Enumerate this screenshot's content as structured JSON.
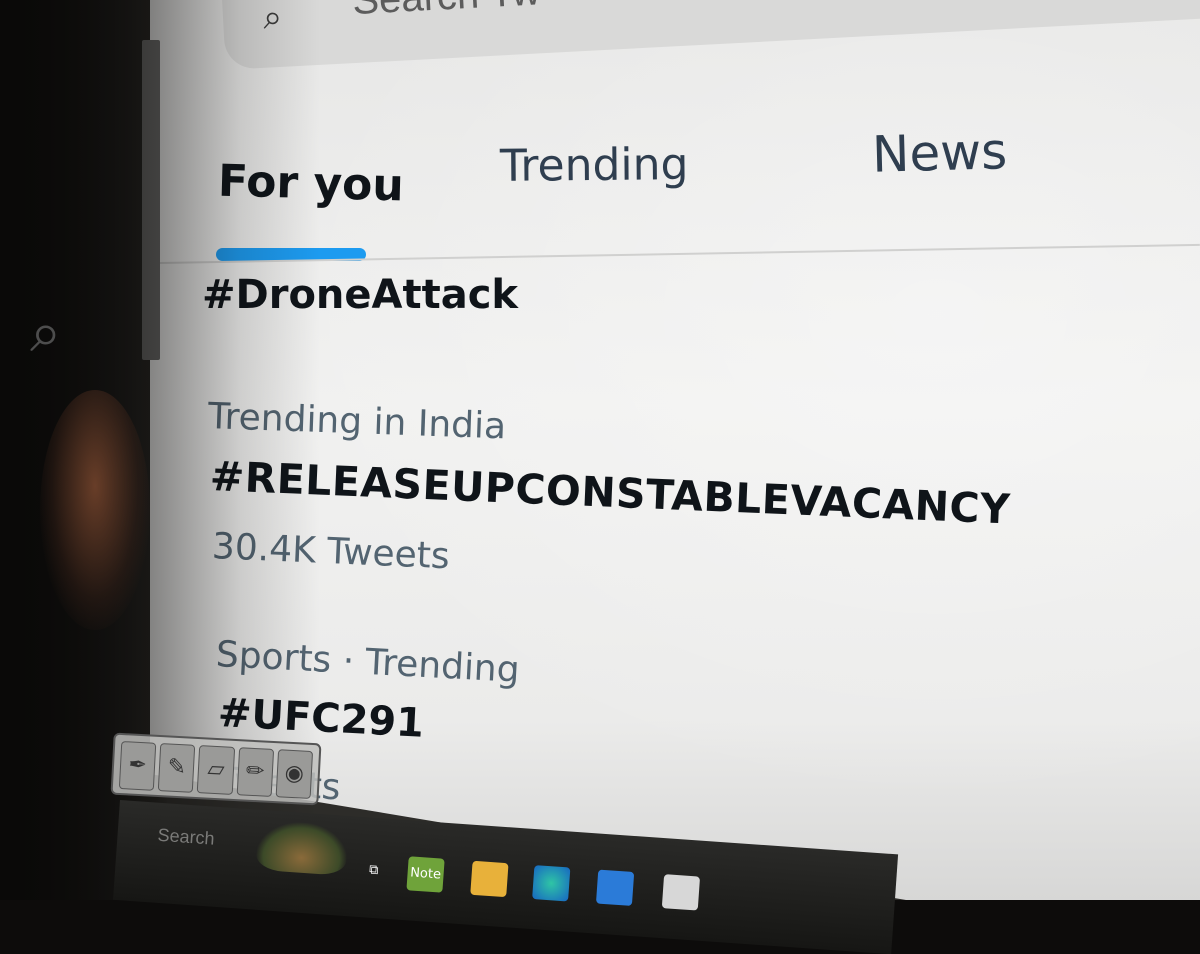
{
  "search": {
    "icon": "search-icon",
    "placeholder": "Search Tw"
  },
  "tabs": [
    {
      "label": "For you",
      "active": true
    },
    {
      "label": "Trending",
      "active": false
    },
    {
      "label": "News",
      "active": false
    }
  ],
  "accent_color": "#1d9bf0",
  "trends": [
    {
      "context": "",
      "tag": "#DroneAttack",
      "count": ""
    },
    {
      "context": "Trending in India",
      "tag": "#RELEASEUPCONSTABLEVACANCY",
      "count": "30.4K Tweets"
    },
    {
      "context": "Sports · Trending",
      "tag": "#UFC291",
      "count": "Tweets"
    }
  ],
  "sidebar": {
    "icon": "search-icon"
  },
  "toolbar": {
    "icons": [
      "pen-icon",
      "marker-icon",
      "eraser-icon",
      "pencil-icon",
      "mouse-icon"
    ]
  },
  "taskbar": {
    "search_label": "Search",
    "apps": [
      {
        "name": "task-view-icon"
      },
      {
        "name": "notes-app-icon",
        "label": "Note"
      },
      {
        "name": "file-explorer-icon"
      },
      {
        "name": "edge-browser-icon"
      },
      {
        "name": "mail-icon"
      },
      {
        "name": "store-icon"
      }
    ]
  }
}
